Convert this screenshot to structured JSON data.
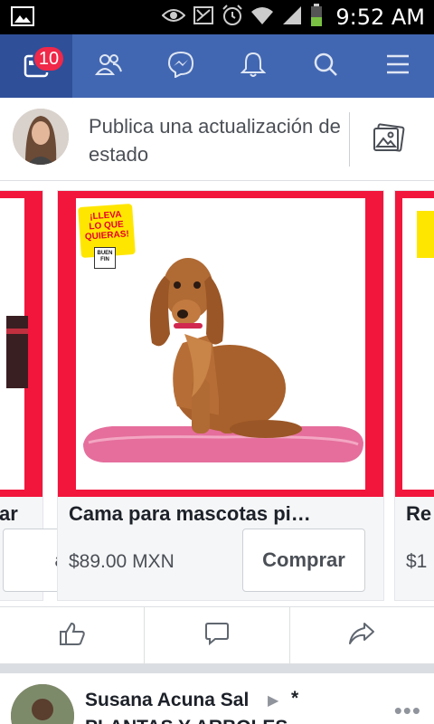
{
  "status_bar": {
    "time": "9:52 AM",
    "icons": [
      "gallery-icon",
      "eye-icon",
      "nfc-icon",
      "alarm-icon",
      "wifi-icon",
      "signal-icon",
      "battery-icon"
    ]
  },
  "nav": {
    "notifications_count": "10",
    "items": [
      "home-icon",
      "friends-icon",
      "messenger-icon",
      "notifications-icon",
      "search-icon",
      "menu-icon"
    ]
  },
  "composer": {
    "placeholder": "Publica una actualización de estado"
  },
  "carousel": {
    "cards": [
      {
        "title": "ar",
        "price": "",
        "button": "ar"
      },
      {
        "title": "Cama para mascotas pi…",
        "price": "$89.00 MXN",
        "button": "Comprar",
        "promo": [
          "¡LLEVA",
          "LO QUE",
          "QUIERAS!"
        ],
        "promo_badge": "BUEN FIN"
      },
      {
        "title": "Re",
        "price": "$1",
        "button": ""
      }
    ]
  },
  "actions": [
    "like-icon",
    "comment-icon",
    "share-icon"
  ],
  "post": {
    "author": "Susana Acuna Sal",
    "suffix": "*",
    "group": "PLANTAS Y ARBOLES",
    "more": "•••"
  },
  "colors": {
    "facebook_blue": "#4267b2",
    "nav_active": "#2f4f99",
    "badge_red": "#f02849",
    "card_frame_red": "#f2163c"
  }
}
